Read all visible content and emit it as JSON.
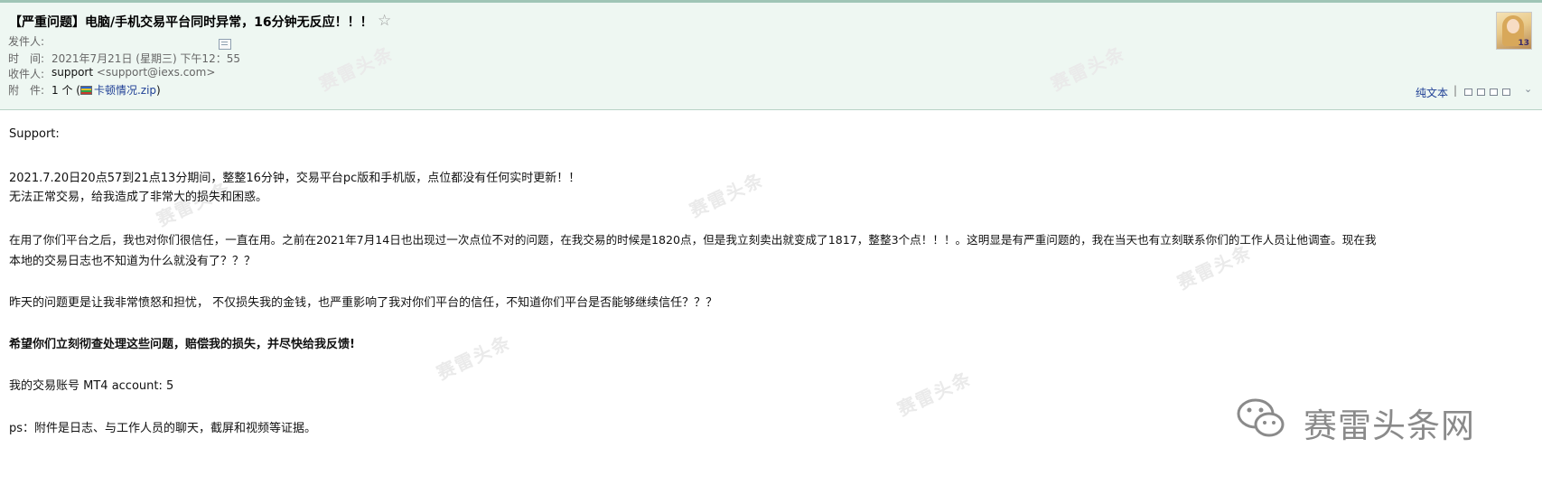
{
  "email": {
    "subject": "【严重问题】电脑/手机交易平台同时异常，16分钟无反应！！！",
    "star_icon": "☆",
    "sender_label": "发件人:",
    "time_label": "时　间:",
    "time_value": "2021年7月21日 (星期三) 下午12：55",
    "recipient_label": "收件人:",
    "recipient_name": "support",
    "recipient_email": "<support@iexs.com>",
    "attachment_label": "附　件:",
    "attachment_count": "1 个 (",
    "attachment_name": "卡顿情况.zip",
    "attachment_close": ")"
  },
  "toolbar": {
    "plain_text": "纯文本",
    "separator": "|",
    "chevron": "⌄"
  },
  "avatar": {
    "badge": "13"
  },
  "body": {
    "greeting": "Support:",
    "line1": "2021.7.20日20点57到21点13分期间，整整16分钟，交易平台pc版和手机版，点位都没有任何实时更新！！",
    "line2": "无法正常交易，给我造成了非常大的损失和困惑。",
    "line3": "在用了你们平台之后，我也对你们很信任，一直在用。之前在2021年7月14日也出现过一次点位不对的问题，在我交易的时候是1820点，但是我立刻卖出就变成了1817，整整3个点！！！。这明显是有严重问题的，我在当天也有立刻联系你们的工作人员让他调查。现在我",
    "line4": "本地的交易日志也不知道为什么就没有了？？？",
    "line5": "昨天的问题更是让我非常愤怒和担忧， 不仅损失我的金钱，也严重影响了我对你们平台的信任，不知道你们平台是否能够继续信任？？？",
    "line6": "希望你们立刻彻查处理这些问题，赔偿我的损失，并尽快给我反馈!",
    "line7": "我的交易账号 MT4 account: 5",
    "line8": "ps：附件是日志、与工作人员的聊天，截屏和视频等证据。"
  },
  "watermark": {
    "text": "赛雷头条",
    "logo_text": "赛雷头条网"
  },
  "colors": {
    "header_bg": "#eef7f2",
    "link": "#1e3f95"
  }
}
